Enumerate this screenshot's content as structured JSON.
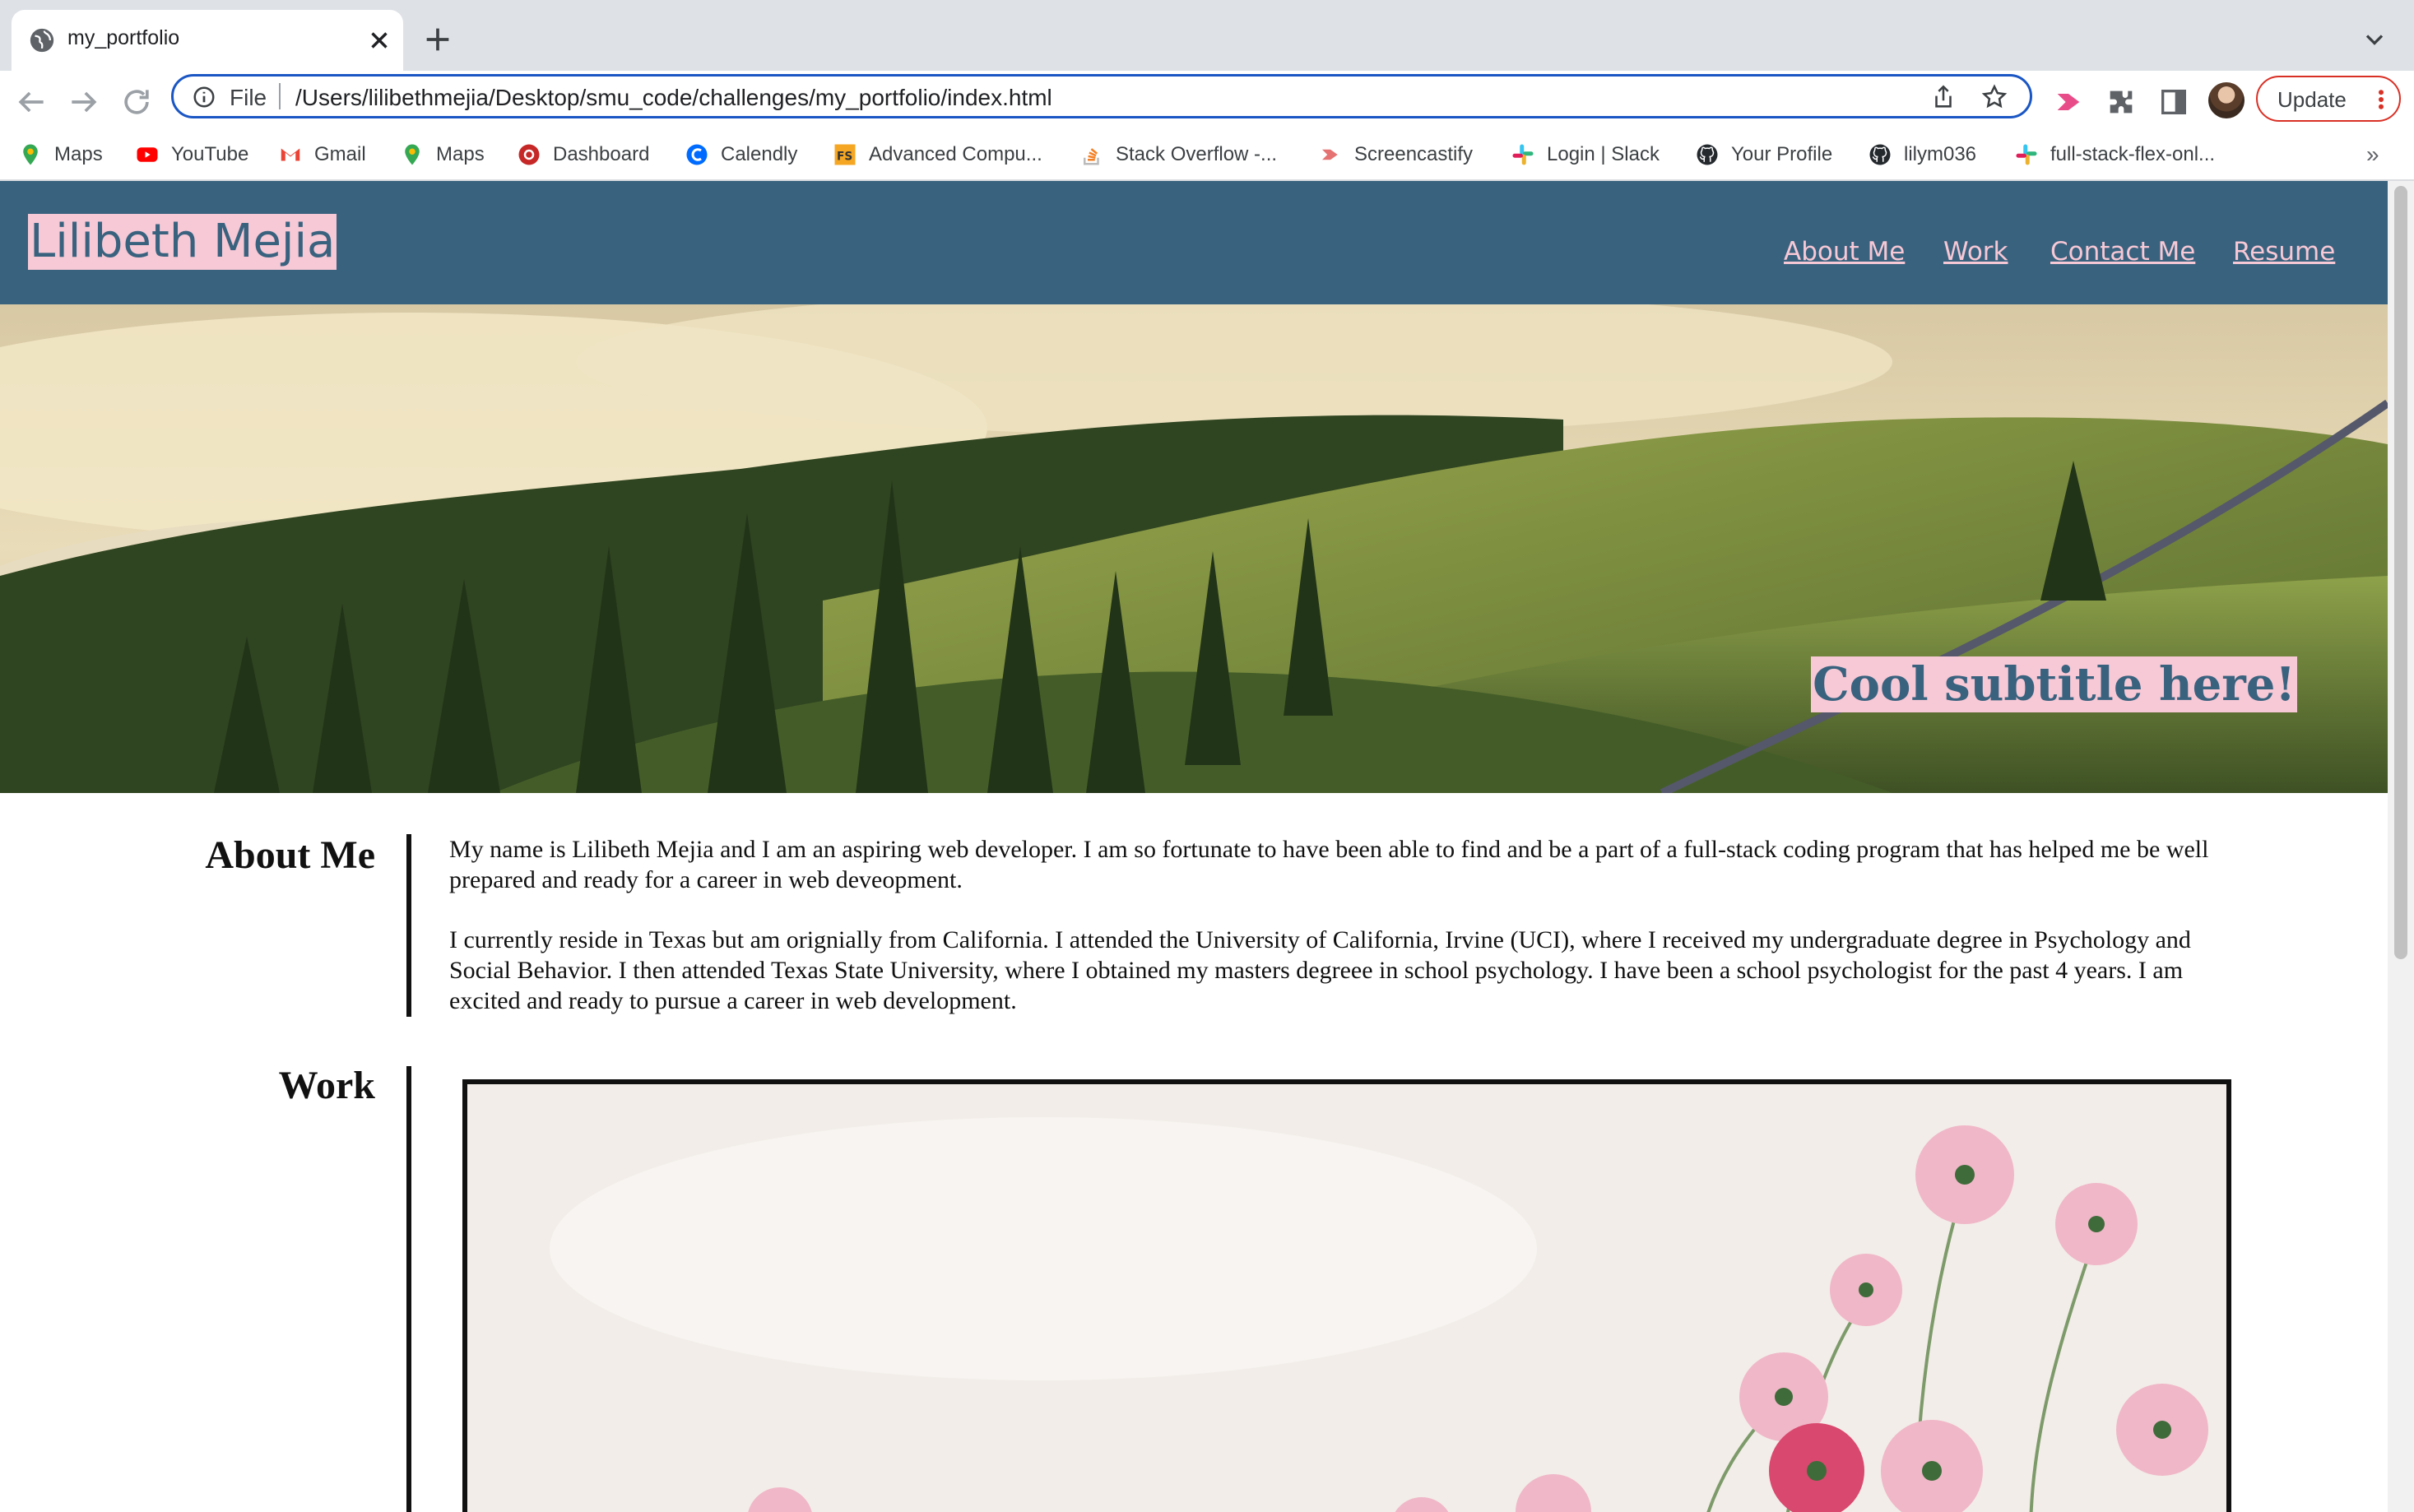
{
  "browser": {
    "tab": {
      "title": "my_portfolio",
      "close_icon": "close-icon",
      "favicon": "globe-icon"
    },
    "address_bar": {
      "scheme_label": "File",
      "url": "/Users/lilibethmejia/Desktop/smu_code/challenges/my_portfolio/index.html"
    },
    "update_label": "Update",
    "bookmarks": [
      {
        "label": "Maps",
        "icon": "maps-pin-icon"
      },
      {
        "label": "YouTube",
        "icon": "youtube-icon"
      },
      {
        "label": "Gmail",
        "icon": "gmail-icon"
      },
      {
        "label": "Maps",
        "icon": "maps-pin-icon"
      },
      {
        "label": "Dashboard",
        "icon": "dashboard-icon"
      },
      {
        "label": "Calendly",
        "icon": "calendly-icon"
      },
      {
        "label": "Advanced Compu...",
        "icon": "fs-icon"
      },
      {
        "label": "Stack Overflow -...",
        "icon": "stackoverflow-icon"
      },
      {
        "label": "Screencastify",
        "icon": "screencastify-icon"
      },
      {
        "label": "Login | Slack",
        "icon": "slack-icon"
      },
      {
        "label": "Your Profile",
        "icon": "github-icon"
      },
      {
        "label": "lilym036",
        "icon": "github-icon"
      },
      {
        "label": "full-stack-flex-onl...",
        "icon": "slack-icon"
      }
    ],
    "more_bookmarks": "»",
    "accent_color": "#1a56c4"
  },
  "site": {
    "name": "Lilibeth Mejia",
    "nav": [
      "About Me",
      "Work",
      "Contact Me",
      "Resume"
    ],
    "hero_subtitle": "Cool subtitle here!",
    "colors": {
      "header": "#39627f",
      "highlight": "#f7c8d5"
    },
    "about": {
      "title": "About Me",
      "paragraphs": [
        "My name is Lilibeth Mejia and I am an aspiring web developer. I am so fortunate to have been able to find and be a part of a full-stack coding program that has helped me be well prepared and ready for a career in web deveopment.",
        "I currently reside in Texas but am orignially from California. I attended the University of California, Irvine (UCI), where I received my undergraduate degree in Psychology and Social Behavior. I then attended Texas State University, where I obtained my masters degreee in school psychology. I have been a school psychologist for the past 4 years. I am excited and ready to pursue a career in web development."
      ]
    },
    "work": {
      "title": "Work"
    }
  }
}
